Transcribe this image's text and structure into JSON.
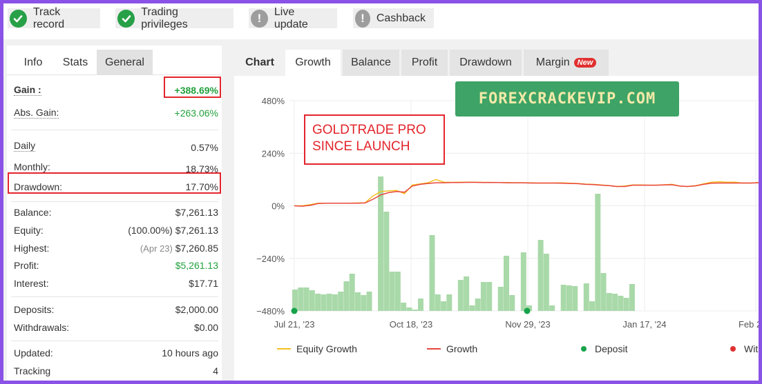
{
  "badges": [
    {
      "label": "Track record",
      "status": "ok",
      "icon": "check-icon"
    },
    {
      "label": "Trading privileges",
      "status": "ok",
      "icon": "check-icon"
    },
    {
      "label": "Live update",
      "status": "warn",
      "icon": "exclamation-icon"
    },
    {
      "label": "Cashback",
      "status": "warn",
      "icon": "exclamation-icon"
    }
  ],
  "left_tabs": [
    "Info",
    "Stats",
    "General"
  ],
  "stats": {
    "gain": {
      "label": "Gain :",
      "value": "+388.69%"
    },
    "abs_gain": {
      "label": "Abs. Gain:",
      "value": "+263.06%"
    },
    "daily": {
      "label": "Daily",
      "value": "0.57%"
    },
    "monthly": {
      "label": "Monthly:",
      "value": "18.73%"
    },
    "drawdown": {
      "label": "Drawdown:",
      "value": "17.70%"
    },
    "balance": {
      "label": "Balance:",
      "value": "$7,261.13"
    },
    "equity": {
      "label": "Equity:",
      "prefix": "(100.00%)",
      "value": "$7,261.13"
    },
    "highest": {
      "label": "Highest:",
      "prefix": "(Apr 23)",
      "value": "$7,260.85"
    },
    "profit": {
      "label": "Profit:",
      "value": "$5,261.13"
    },
    "interest": {
      "label": "Interest:",
      "value": "$17.71"
    },
    "deposits": {
      "label": "Deposits:",
      "value": "$2,000.00"
    },
    "withdrawals": {
      "label": "Withdrawals:",
      "value": "$0.00"
    },
    "updated": {
      "label": "Updated:",
      "value": "10 hours ago"
    },
    "tracking": {
      "label": "Tracking",
      "value": "4"
    }
  },
  "right_tabs": {
    "chart": "Chart",
    "items": [
      "Growth",
      "Balance",
      "Profit",
      "Drawdown",
      "Margin"
    ],
    "active": "Growth",
    "new_badge": "New"
  },
  "watermark": "FOREXCRACKEVIP.COM",
  "annotation": {
    "line1": "GOLDTRADE PRO",
    "line2": "SINCE LAUNCH"
  },
  "colors": {
    "equity_growth": "#f4c020",
    "growth": "#e8463c",
    "deposit": "#16a34a",
    "withdrawal": "#e03030",
    "profit_bars": "#a9d9a9",
    "highlight_box": "#e3242b",
    "ok": "#27a047"
  },
  "chart_data": {
    "type": "line",
    "y_ticks": [
      "480%",
      "240%",
      "0%",
      "−240%",
      "−480%"
    ],
    "ylim": [
      -480,
      480
    ],
    "x_ticks": [
      "Jul 21, '23",
      "Oct 18, '23",
      "Nov 29, '23",
      "Jan 17, '24",
      "Feb 2"
    ],
    "series": [
      {
        "name": "Equity Growth",
        "values": [
          0,
          0,
          5,
          12,
          12,
          12,
          12,
          12,
          13,
          14,
          45,
          65,
          68,
          70,
          55,
          95,
          100,
          105,
          120,
          108,
          107,
          108,
          108,
          108,
          107,
          107,
          106,
          106,
          105,
          105,
          105,
          104,
          104,
          104,
          105,
          103,
          102,
          99,
          98,
          95,
          92,
          88,
          90,
          95,
          95,
          94,
          94,
          96,
          98,
          90,
          88,
          92,
          100,
          108,
          110,
          108,
          108,
          104,
          104,
          106
        ]
      },
      {
        "name": "Growth",
        "values": [
          0,
          -2,
          2,
          10,
          12,
          12,
          12,
          12,
          12,
          13,
          30,
          50,
          60,
          65,
          62,
          90,
          98,
          102,
          105,
          105,
          106,
          106,
          107,
          107,
          106,
          106,
          106,
          105,
          105,
          105,
          104,
          104,
          104,
          104,
          103,
          102,
          101,
          98,
          97,
          94,
          92,
          88,
          88,
          94,
          94,
          94,
          94,
          95,
          96,
          90,
          88,
          91,
          98,
          103,
          104,
          104,
          104,
          104,
          104,
          105
        ]
      }
    ],
    "bars": {
      "name": "Profit",
      "values": [
        -12,
        -6,
        -4,
        -4,
        -6,
        -6,
        -6,
        -2,
        4,
        14,
        -8,
        -6,
        -6,
        -4,
        -10,
        -12,
        88,
        -7,
        -3,
        -1,
        0,
        0,
        0,
        0,
        0,
        0,
        0,
        0,
        0,
        0,
        0,
        0,
        0,
        0,
        0,
        0,
        0,
        0,
        0,
        0,
        0,
        0,
        0,
        0,
        0,
        0,
        0,
        0,
        0,
        0,
        0,
        0,
        0,
        0,
        0,
        0,
        0,
        0,
        0,
        0
      ]
    },
    "deposits": [
      {
        "x_index": 0,
        "value": -480
      },
      {
        "x_index": 20,
        "value": -480
      }
    ],
    "legend": [
      "Equity Growth",
      "Growth",
      "Deposit",
      "Wit"
    ]
  }
}
